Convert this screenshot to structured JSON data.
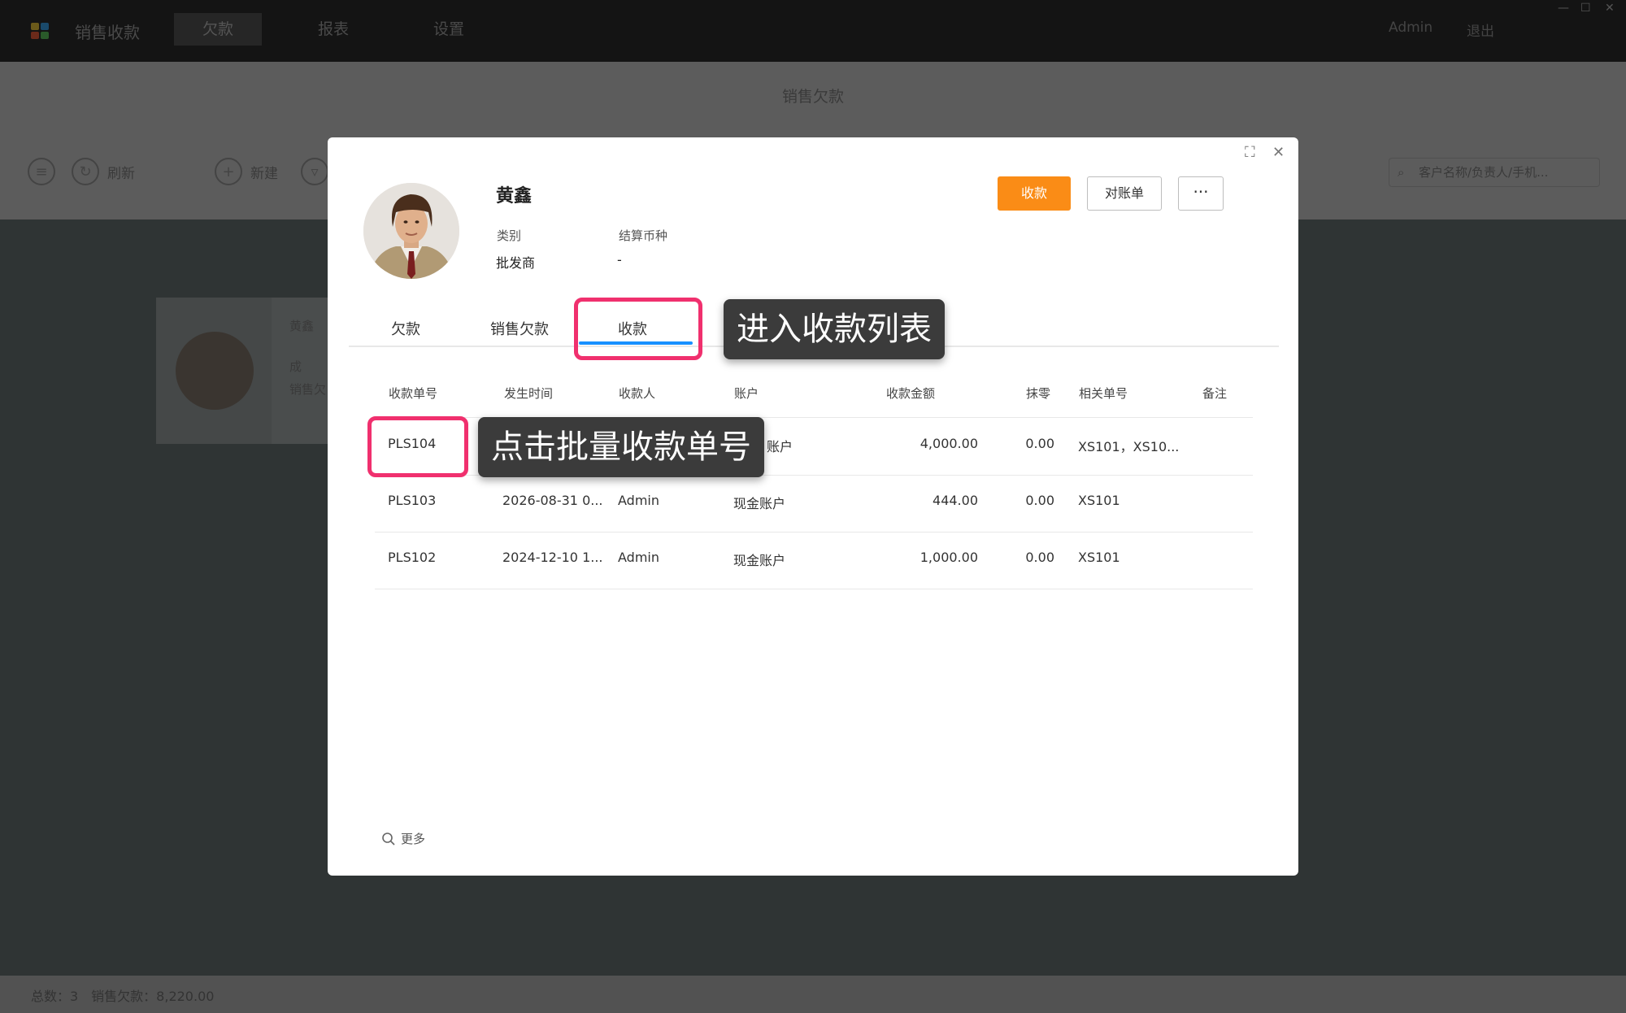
{
  "app": {
    "title": "销售收款",
    "nav": [
      "欠款",
      "报表",
      "设置"
    ],
    "user": "Admin",
    "logout": "退出",
    "page_title": "销售欠款",
    "toolbar": {
      "refresh": "刷新",
      "new": "新建"
    },
    "search_placeholder": "客户名称/负责人/手机...",
    "card": {
      "name": "黄鑫",
      "line1": "成",
      "line2": "销售欠"
    },
    "footer": "总数：3　销售欠款：8,220.00"
  },
  "modal": {
    "customer_name": "黄鑫",
    "category_label": "类别",
    "category_value": "批发商",
    "currency_label": "结算币种",
    "currency_value": "-",
    "buttons": {
      "collect": "收款",
      "statement": "对账单",
      "more": "···"
    },
    "tabs": [
      "欠款",
      "销售欠款",
      "收款"
    ],
    "active_tab": "收款",
    "table": {
      "headers": [
        "收款单号",
        "发生时间",
        "收款人",
        "账户",
        "收款金额",
        "抹零",
        "相关单号",
        "备注"
      ],
      "rows": [
        [
          "PLS104",
          "",
          "",
          "账户",
          "4,000.00",
          "0.00",
          "XS101，XS10...",
          ""
        ],
        [
          "PLS103",
          "2026-08-31 0...",
          "Admin",
          "现金账户",
          "444.00",
          "0.00",
          "XS101",
          ""
        ],
        [
          "PLS102",
          "2024-12-10 1...",
          "Admin",
          "现金账户",
          "1,000.00",
          "0.00",
          "XS101",
          ""
        ]
      ]
    },
    "more_label": "更多"
  },
  "annotations": {
    "tab_tip": "进入收款列表",
    "row_tip": "点击批量收款单号",
    "highlight_color": "#f0306e"
  },
  "colors": {
    "primary": "#fa8c16",
    "tab_active": "#1890ff"
  }
}
